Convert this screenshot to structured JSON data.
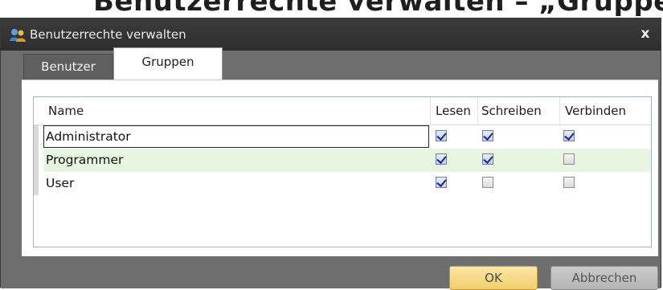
{
  "background_caption": {
    "text": "Benutzerrechte verwalten – „Gruppen“"
  },
  "window": {
    "title": "Benutzerrechte verwalten",
    "icon": "users-icon",
    "close_label": "x"
  },
  "tabs": [
    {
      "label": "Benutzer",
      "active": false
    },
    {
      "label": "Gruppen",
      "active": true
    }
  ],
  "grid": {
    "columns": [
      "Name",
      "Lesen",
      "Schreiben",
      "Verbinden"
    ],
    "rows": [
      {
        "name": "Administrator",
        "lesen": true,
        "schreiben": true,
        "verbinden": true
      },
      {
        "name": "Programmer",
        "lesen": true,
        "schreiben": true,
        "verbinden": false
      },
      {
        "name": "User",
        "lesen": true,
        "schreiben": false,
        "verbinden": false
      }
    ]
  },
  "buttons": {
    "ok": "OK",
    "cancel": "Abbrechen"
  },
  "colors": {
    "titlebar": "#2e2e2e",
    "window_bg": "#6e6e6e",
    "alt_row": "#e6f6e0",
    "ok_button": "#f2cd6a",
    "grid_border": "#9fb3c8"
  }
}
